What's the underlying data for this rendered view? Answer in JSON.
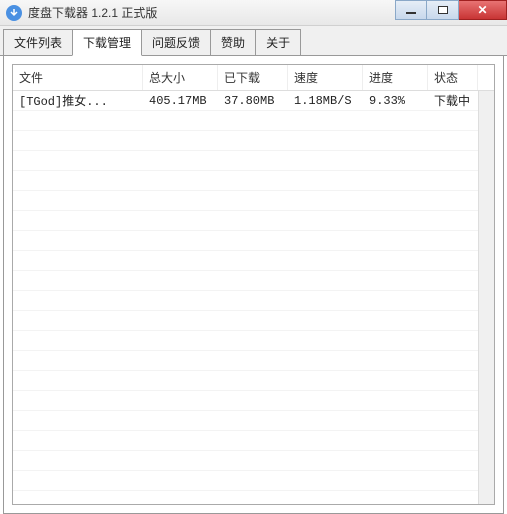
{
  "window": {
    "title": "度盘下载器 1.2.1 正式版"
  },
  "tabs": [
    {
      "label": "文件列表"
    },
    {
      "label": "下载管理"
    },
    {
      "label": "问题反馈"
    },
    {
      "label": "赞助"
    },
    {
      "label": "关于"
    }
  ],
  "activeTabIndex": 1,
  "columns": {
    "file": "文件",
    "size": "总大小",
    "downloaded": "已下载",
    "speed": "速度",
    "progress": "进度",
    "status": "状态"
  },
  "rows": [
    {
      "file": "[TGod]推女...",
      "size": "405.17MB",
      "downloaded": "37.80MB",
      "speed": "1.18MB/S",
      "progress": "9.33%",
      "status": "下载中"
    }
  ]
}
